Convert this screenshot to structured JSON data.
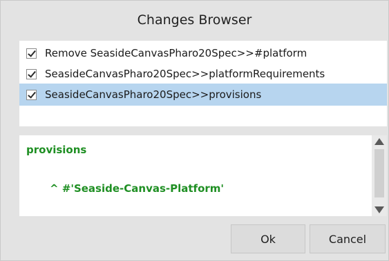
{
  "window": {
    "title": "Changes Browser"
  },
  "changes": [
    {
      "label": "Remove SeasideCanvasPharo20Spec>>#platform",
      "checked": true,
      "selected": false
    },
    {
      "label": "SeasideCanvasPharo20Spec>>platformRequirements",
      "checked": true,
      "selected": false
    },
    {
      "label": "SeasideCanvasPharo20Spec>>provisions",
      "checked": true,
      "selected": true
    }
  ],
  "code": {
    "method": "provisions",
    "body": "^ #'Seaside-Canvas-Platform'",
    "color": "#1f8f23"
  },
  "buttons": {
    "ok": "Ok",
    "cancel": "Cancel"
  },
  "colors": {
    "selection": "#b7d5ef",
    "window_bg": "#e3e3e3"
  }
}
